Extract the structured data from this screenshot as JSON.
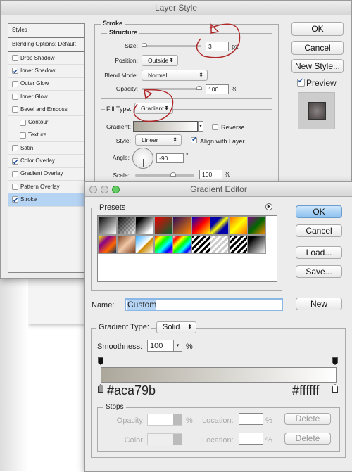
{
  "layer_style": {
    "title": "Layer Style",
    "styles_header": "Styles",
    "blending": "Blending Options: Default",
    "items": [
      {
        "label": "Drop Shadow",
        "checked": false
      },
      {
        "label": "Inner Shadow",
        "checked": true
      },
      {
        "label": "Outer Glow",
        "checked": false
      },
      {
        "label": "Inner Glow",
        "checked": false
      },
      {
        "label": "Bevel and Emboss",
        "checked": false
      },
      {
        "label": "Contour",
        "checked": false
      },
      {
        "label": "Texture",
        "checked": false
      },
      {
        "label": "Satin",
        "checked": false
      },
      {
        "label": "Color Overlay",
        "checked": true
      },
      {
        "label": "Gradient Overlay",
        "checked": false
      },
      {
        "label": "Pattern Overlay",
        "checked": false
      },
      {
        "label": "Stroke",
        "checked": true,
        "selected": true
      }
    ],
    "stroke_legend": "Stroke",
    "structure_legend": "Structure",
    "size_label": "Size:",
    "size_value": "3",
    "size_unit": "px",
    "position_label": "Position:",
    "position_value": "Outside",
    "blend_label": "Blend Mode:",
    "blend_value": "Normal",
    "opacity_label": "Opacity:",
    "opacity_value": "100",
    "opacity_unit": "%",
    "filltype_label": "Fill Type:",
    "filltype_value": "Gradient",
    "gradient_label": "Gradient:",
    "reverse_label": "Reverse",
    "style_label": "Style:",
    "style_value": "Linear",
    "align_label": "Align with Layer",
    "angle_label": "Angle:",
    "angle_value": "-90",
    "angle_unit": "°",
    "scale_label": "Scale:",
    "scale_value": "100",
    "scale_unit": "%",
    "ok": "OK",
    "cancel": "Cancel",
    "new_style": "New Style...",
    "preview": "Preview"
  },
  "gradient_editor": {
    "title": "Gradient Editor",
    "presets_legend": "Presets",
    "ok": "OK",
    "cancel": "Cancel",
    "load": "Load...",
    "save": "Save...",
    "new": "New",
    "name_label": "Name:",
    "name_value": "Custom",
    "type_label": "Gradient Type:",
    "type_value": "Solid",
    "smoothness_label": "Smoothness:",
    "smoothness_value": "100",
    "smoothness_unit": "%",
    "start_color": "#aca79b",
    "end_color": "#ffffff",
    "stops_legend": "Stops",
    "opacity_label": "Opacity:",
    "color_label": "Color:",
    "location_label": "Location:",
    "pct": "%",
    "delete": "Delete"
  },
  "colors": {
    "annotation": "#b0282a",
    "selection": "#b5d3f3",
    "accent": "#8cc0ef"
  }
}
